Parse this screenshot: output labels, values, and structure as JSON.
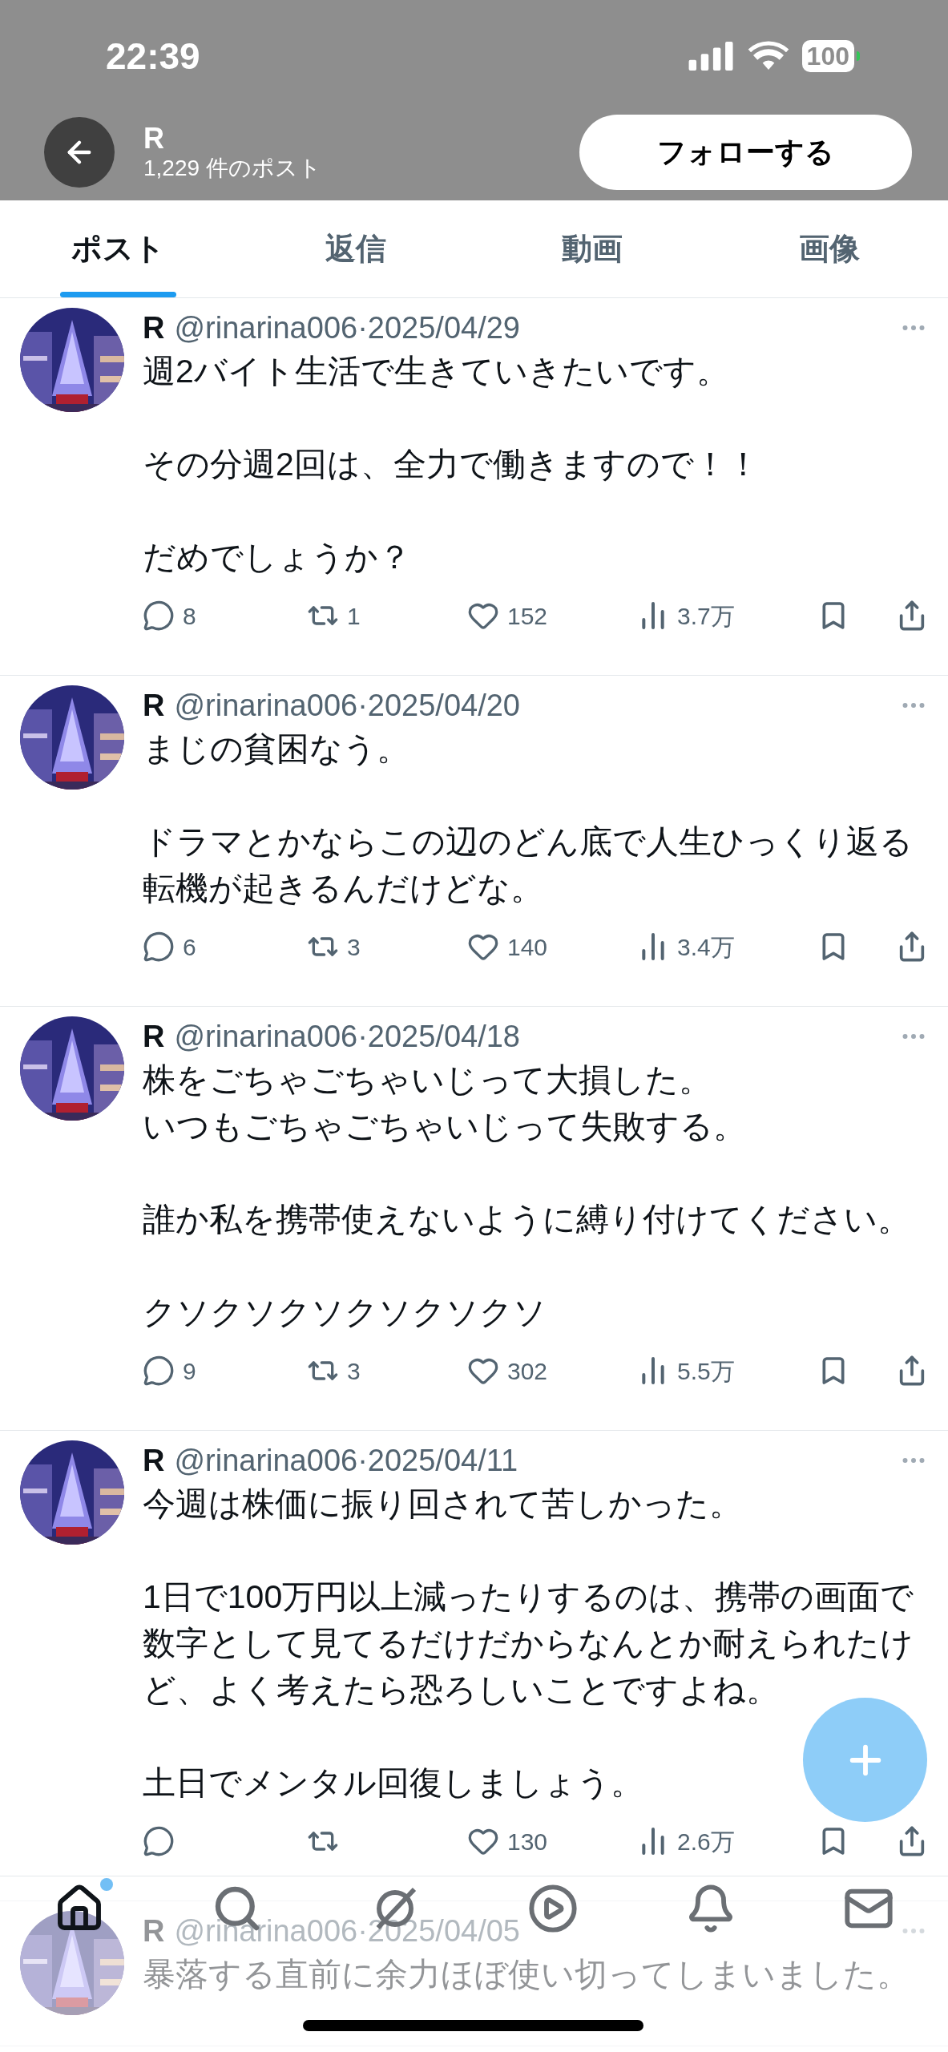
{
  "status_bar": {
    "time": "22:39",
    "battery": "100"
  },
  "header": {
    "name": "R",
    "post_count": "1,229 件のポスト",
    "follow_button": "フォローする"
  },
  "tabs": [
    {
      "label": "ポスト",
      "selected": true
    },
    {
      "label": "返信",
      "selected": false
    },
    {
      "label": "動画",
      "selected": false
    },
    {
      "label": "画像",
      "selected": false
    }
  ],
  "posts": [
    {
      "name": "R",
      "meta": "@rinarina006·2025/04/29",
      "paragraphs": [
        [
          "週2バイト生活で生きていきたいです。"
        ],
        [
          "その分週2回は、全力で働きますので！！"
        ],
        [
          "だめでしょうか？"
        ]
      ],
      "replies": "8",
      "reposts": "1",
      "likes": "152",
      "views": "3.7万"
    },
    {
      "name": "R",
      "meta": "@rinarina006·2025/04/20",
      "paragraphs": [
        [
          "まじの貧困なう。"
        ],
        [
          "ドラマとかならこの辺のどん底で人生ひっくり返る転機が起きるんだけどな。"
        ]
      ],
      "replies": "6",
      "reposts": "3",
      "likes": "140",
      "views": "3.4万"
    },
    {
      "name": "R",
      "meta": "@rinarina006·2025/04/18",
      "paragraphs": [
        [
          "株をごちゃごちゃいじって大損した。",
          "いつもごちゃごちゃいじって失敗する。"
        ],
        [
          "誰か私を携帯使えないように縛り付けてください。"
        ],
        [
          "クソクソクソクソクソクソ"
        ]
      ],
      "replies": "9",
      "reposts": "3",
      "likes": "302",
      "views": "5.5万"
    },
    {
      "name": "R",
      "meta": "@rinarina006·2025/04/11",
      "paragraphs": [
        [
          "今週は株価に振り回されて苦しかった。"
        ],
        [
          "1日で100万円以上減ったりするのは、携帯の画面で数字として見てるだけだからなんとか耐えられたけど、よく考えたら恐ろしいことですよね。"
        ],
        [
          "土日でメンタル回復しましょう。"
        ]
      ],
      "likes": "130",
      "views": "2.6万"
    },
    {
      "name": "R",
      "meta": "@rinarina006·2025/04/05",
      "paragraphs": [
        [
          "暴落する直前に余力ほぼ使い切ってしまいました。"
        ]
      ]
    }
  ],
  "bottom_nav": [
    {
      "kind": "home",
      "selected": true,
      "badge": true
    },
    {
      "kind": "search",
      "selected": false,
      "badge": false
    },
    {
      "kind": "grok",
      "selected": false,
      "badge": false
    },
    {
      "kind": "video",
      "selected": false,
      "badge": false
    },
    {
      "kind": "notifications",
      "selected": false,
      "badge": false
    },
    {
      "kind": "messages",
      "selected": false,
      "badge": false
    }
  ]
}
